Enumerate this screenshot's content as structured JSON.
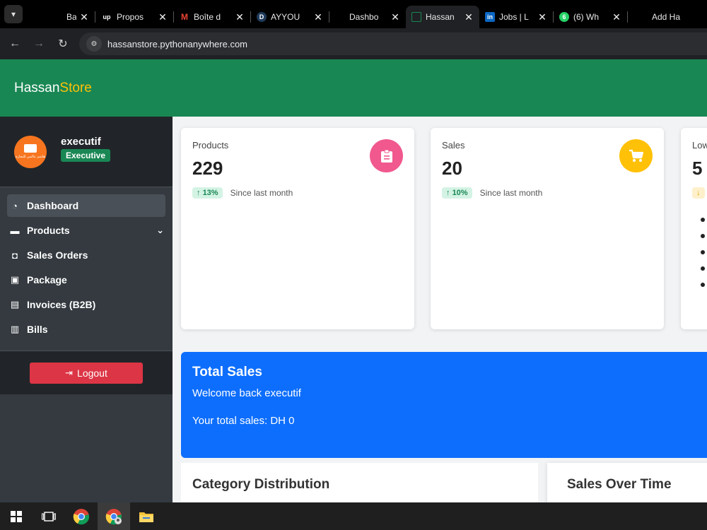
{
  "browser": {
    "tabs": [
      {
        "title": "Bash co",
        "favicon": "",
        "active": false
      },
      {
        "title": "Propos",
        "favicon": "up",
        "active": false
      },
      {
        "title": "Boîte d",
        "favicon": "M",
        "active": false
      },
      {
        "title": "AYYOU",
        "favicon": "D",
        "active": false
      },
      {
        "title": "Dashbo",
        "favicon": "",
        "active": false
      },
      {
        "title": "Hassan",
        "favicon": "",
        "active": true
      },
      {
        "title": "Jobs | L",
        "favicon": "in",
        "active": false
      },
      {
        "title": "(6) Wh",
        "favicon": "6",
        "active": false
      },
      {
        "title": "Add Ha",
        "favicon": "",
        "active": false
      }
    ],
    "url": "hassanstore.pythonanywhere.com"
  },
  "header": {
    "brand_part1": "Hassan",
    "brand_part2": "Store"
  },
  "sidebar": {
    "user_name": "executif",
    "role_badge": "Executive",
    "avatar_text": "ھاشم عالمي للتجارة",
    "items": [
      {
        "label": "Dashboard",
        "icon": "gauge-icon",
        "active": true
      },
      {
        "label": "Products",
        "icon": "folder-icon",
        "has_caret": true
      },
      {
        "label": "Sales Orders",
        "icon": "shopping-bag-icon"
      },
      {
        "label": "Package",
        "icon": "box-icon"
      },
      {
        "label": "Invoices (B2B)",
        "icon": "invoice-icon"
      },
      {
        "label": "Bills",
        "icon": "receipt-icon"
      }
    ],
    "logout_label": "Logout"
  },
  "stats": [
    {
      "label": "Products",
      "value": "229",
      "change": "13%",
      "note": "Since last month",
      "icon": "clipboard-icon",
      "color": "#f0588e"
    },
    {
      "label": "Sales",
      "value": "20",
      "change": "10%",
      "note": "Since last month",
      "icon": "cart-icon",
      "color": "#ffc107"
    },
    {
      "label": "Low",
      "value": "5",
      "change": "",
      "note": "",
      "icon": "",
      "color": "#ffc107"
    }
  ],
  "banner": {
    "title": "Total Sales",
    "welcome": "Welcome back executif",
    "total": "Your total sales: DH 0"
  },
  "sections": {
    "category": "Category Distribution",
    "sales_over_time": "Sales Over Time"
  },
  "colors": {
    "header_green": "#198754",
    "sidebar_dark": "#343a40",
    "banner_blue": "#0d6efd",
    "logout_red": "#dc3545"
  }
}
